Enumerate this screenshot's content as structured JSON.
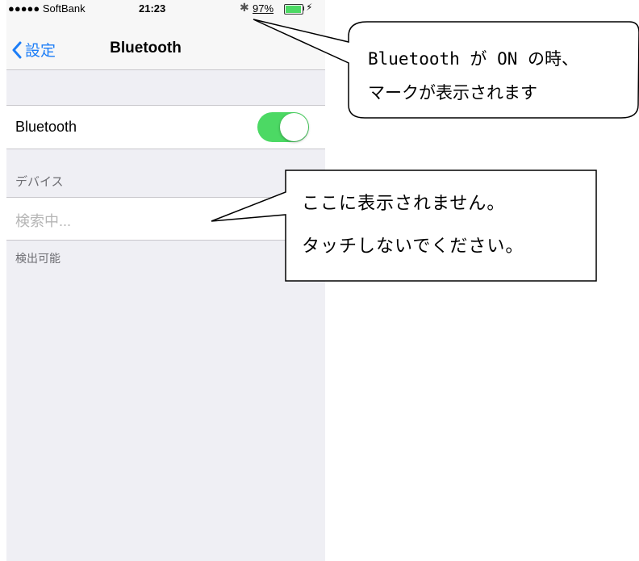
{
  "status_bar": {
    "carrier": "●●●●● SoftBank",
    "time": "21:23",
    "bluetooth_icon": "bluetooth-icon",
    "battery_percent": "97%",
    "battery_level": 0.97,
    "charging_icon": "lightning-icon"
  },
  "nav": {
    "back_label": "設定",
    "back_icon": "chevron-left-icon",
    "title": "Bluetooth"
  },
  "settings": {
    "bluetooth_label": "Bluetooth",
    "bluetooth_enabled": true,
    "devices_header": "デバイス",
    "searching_text": "検索中...",
    "discoverable_text": "検出可能"
  },
  "annotations": {
    "callout_status": {
      "line1": "Bluetooth が ON の時、",
      "line2": "マークが表示されます"
    },
    "callout_devices": {
      "line1": "ここに表示されません。",
      "line2": "タッチしないでください。"
    }
  },
  "colors": {
    "accent": "#1d7ef7",
    "toggle_on": "#4cd964",
    "background": "#efeff4"
  }
}
